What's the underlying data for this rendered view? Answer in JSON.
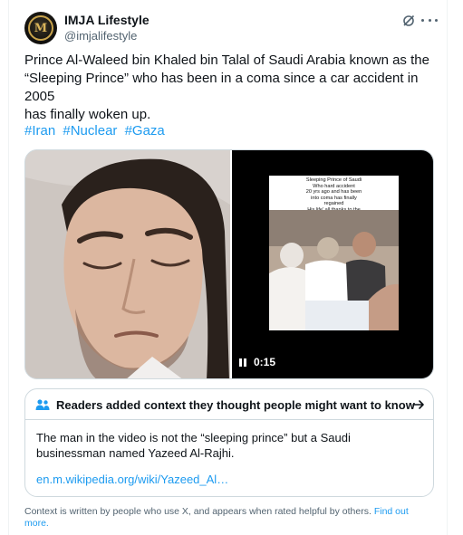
{
  "author": {
    "name": "IMJA Lifestyle",
    "handle": "@imjalifestyle",
    "avatar_initials": "M",
    "avatar_icon": "imja-logo-icon"
  },
  "tweet": {
    "text": "Prince Al-Waleed bin Khaled bin Talal of Saudi Arabia known as the\n“Sleeping Prince” who has been in a coma since a car accident in 2005\nhas finally woken up.",
    "hashtags": [
      "#Iran",
      "#Nuclear",
      "#Gaza"
    ]
  },
  "media": {
    "video_caption": "Sleeping Prince of Saudi\nWho hard accident\n20 yrs ago and has been\ninto coma has finally\nregained\nHis life' all thanks to the\nfather who refused to give\nup on him",
    "video_time": "0:15"
  },
  "note": {
    "title": "Readers added context they thought people might want to know",
    "body": "The man in the video is not the “sleeping prince” but a Saudi businessman named Yazeed Al-Rajhi.",
    "link": "en.m.wikipedia.org/wiki/Yazeed_Al…"
  },
  "footer": {
    "text": "Context is written by people who use X, and appears when rated helpful by others.",
    "find_out_more": "Find out more."
  },
  "colors": {
    "accent": "#1d9bf0",
    "text": "#0f1419",
    "muted": "#536471",
    "border": "#cfd9de"
  }
}
